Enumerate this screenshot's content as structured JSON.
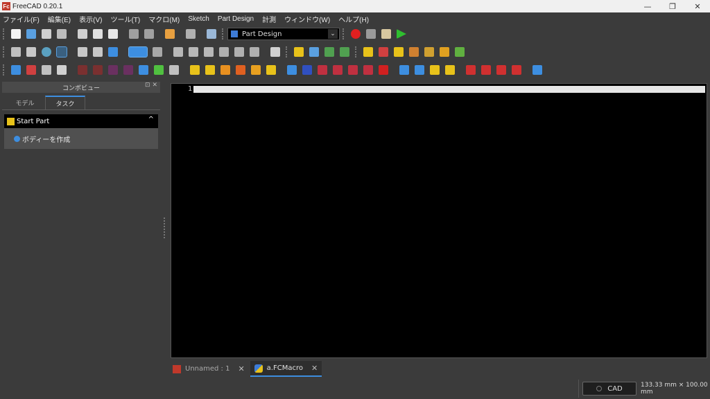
{
  "window": {
    "title": "FreeCAD 0.20.1",
    "app_icon_text": "Fc",
    "minimize": "—",
    "maximize": "❐",
    "close": "✕"
  },
  "menu": [
    "ファイル(F)",
    "編集(E)",
    "表示(V)",
    "ツール(T)",
    "マクロ(M)",
    "Sketch",
    "Part Design",
    "計測",
    "ウィンドウ(W)",
    "ヘルプ(H)"
  ],
  "workbench_selector": {
    "value": "Part Design",
    "arrow": "⌄"
  },
  "combo_view": {
    "title": "コンボビュー",
    "buttons": "⊡ ✕",
    "tabs": [
      "モデル",
      "タスク"
    ],
    "active_tab": "タスク",
    "task_panel": {
      "header": "Start Part",
      "collapse": "^",
      "action": "ボディーを作成"
    }
  },
  "editor": {
    "line_numbers": [
      "1"
    ]
  },
  "doc_tabs": [
    {
      "label": "Unnamed : 1",
      "close": "✕",
      "icon": "freecad-doc-icon"
    },
    {
      "label": "a.FCMacro",
      "close": "✕",
      "icon": "python-macro-icon"
    }
  ],
  "status": {
    "navigation": "CAD",
    "dimensions": "133.33 mm × 100.00 mm"
  },
  "colors": {
    "accent_blue": "#3d8ee0",
    "record_red": "#e02020",
    "run_green": "#2fbf2f",
    "part_yellow": "#e8c21a"
  }
}
